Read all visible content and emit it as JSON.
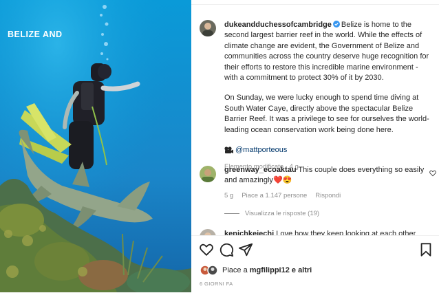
{
  "photo": {
    "overlay_text": "BELIZE AND"
  },
  "post": {
    "username": "dukeandduchessofcambridge",
    "caption_p1": "Belize is home to the second largest barrier reef in the world. While the effects of climate change are evident, the Government of Belize and communities across the country deserve huge recognition for their efforts to restore this incredible marine environment - with a commitment to protect 30% of it by 2030.",
    "caption_p2": "On Sunday, we were lucky enough to spend time diving at South Water Caye, directly above the spectacular Belize Barrier Reef. It was a privilege to see for ourselves the world-leading ocean conservation work being done here.",
    "credit_mention": "@mattporteous",
    "edited_label": "Elemento modificato",
    "edited_time": "4 g"
  },
  "comments": [
    {
      "username": "greenway_ecoaktau",
      "text": "This couple does everything so easily and amazingly",
      "emoji": "❤️😍",
      "time": "5 g",
      "likes": "Piace a 1.147 persone",
      "reply_label": "Rispondi",
      "view_replies": "Visualizza le risposte (19)"
    },
    {
      "username": "kenichkeiechi",
      "text": "Love how they keep looking at each other"
    }
  ],
  "actions": {
    "liked_by_prefix": "Piace a",
    "liked_by_user": "mgfilippi12",
    "liked_by_suffix": "e altri",
    "date": "6 GIORNI FA"
  },
  "colors": {
    "link": "#00376b",
    "verified": "#3897f0",
    "meta_gray": "#8e8e8e",
    "heart_red": "#ed4956"
  }
}
